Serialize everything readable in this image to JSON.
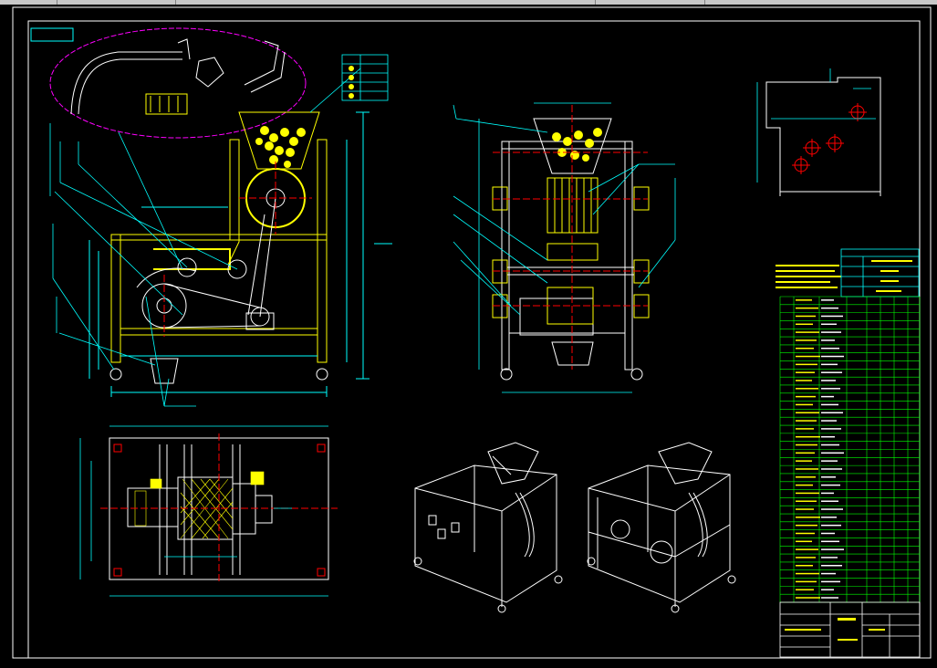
{
  "window": {
    "tab_count": 5
  },
  "colors": {
    "background": "#000000",
    "frame": "#ffffff",
    "dimension": "#00ffff",
    "leader": "#00ffff",
    "part_outline": "#ffff00",
    "centerline": "#ff0000",
    "detail_circle": "#ff00ff",
    "table_lines": "#00ff00",
    "iso_lines": "#ffffff"
  },
  "drawing": {
    "views": [
      "front-view",
      "side-view",
      "top-view",
      "iso-view-left",
      "iso-view-right",
      "detail-view",
      "inset-detail"
    ],
    "parts_list_rows": 38
  }
}
